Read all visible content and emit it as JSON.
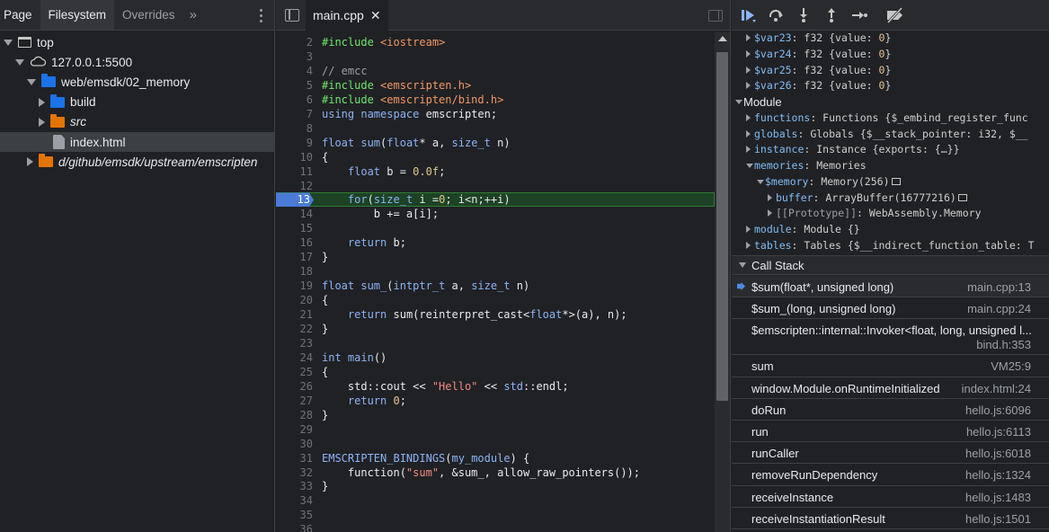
{
  "navigator": {
    "tabs": [
      "Page",
      "Filesystem",
      "Overrides"
    ],
    "more": "»",
    "tree": [
      {
        "label": "top",
        "icon": "frame-icon",
        "expanded": true,
        "indent": 0
      },
      {
        "label": "127.0.0.1:5500",
        "icon": "cloud-icon",
        "expanded": true,
        "indent": 1
      },
      {
        "label": "web/emsdk/02_memory",
        "icon": "folder-icon",
        "expanded": true,
        "indent": 2
      },
      {
        "label": "build",
        "icon": "folder-icon",
        "expanded": false,
        "indent": 3
      },
      {
        "label": "src",
        "icon": "folder-icon",
        "expanded": false,
        "indent": 3,
        "italic": true,
        "color": "orange"
      },
      {
        "label": "index.html",
        "icon": "file-icon",
        "indent": 3,
        "selected": true
      },
      {
        "label": "d/github/emsdk/upstream/emscripten",
        "icon": "folder-icon",
        "expanded": false,
        "indent": 2,
        "italic": true,
        "color": "orange"
      }
    ]
  },
  "editor": {
    "filename": "main.cpp",
    "close_glyph": "✕",
    "execution_line": 13,
    "lines": [
      {
        "n": "2",
        "html": "<span class=\"pp\">#include</span> <span class=\"inc\">&lt;iostream&gt;</span>"
      },
      {
        "n": "3",
        "html": ""
      },
      {
        "n": "4",
        "html": "<span class=\"com\">// emcc</span>"
      },
      {
        "n": "5",
        "html": "<span class=\"pp\">#include</span> <span class=\"inc\">&lt;emscripten.h&gt;</span>"
      },
      {
        "n": "6",
        "html": "<span class=\"pp\">#include</span> <span class=\"inc\">&lt;emscripten/bind.h&gt;</span>"
      },
      {
        "n": "7",
        "html": "<span class=\"kw\">using</span> <span class=\"kw\">namespace</span> emscripten;"
      },
      {
        "n": "8",
        "html": ""
      },
      {
        "n": "9",
        "html": "<span class=\"ty\">float</span> <span class=\"fn\">sum</span>(<span class=\"ty\">float</span>* a, <span class=\"ty\">size_t</span> n)"
      },
      {
        "n": "10",
        "html": "{"
      },
      {
        "n": "11",
        "html": "    <span class=\"ty\">float</span> b = <span class=\"num\">0.0f</span>;"
      },
      {
        "n": "12",
        "html": ""
      },
      {
        "n": "13",
        "html": "    <span class=\"kw\">for</span>(<span class=\"ty\">size_t</span> i =<span class=\"num\">0</span>; i&lt;n;++i)"
      },
      {
        "n": "14",
        "html": "        b += a[i];"
      },
      {
        "n": "15",
        "html": ""
      },
      {
        "n": "16",
        "html": "    <span class=\"kw\">return</span> b;"
      },
      {
        "n": "17",
        "html": "}"
      },
      {
        "n": "18",
        "html": ""
      },
      {
        "n": "19",
        "html": "<span class=\"ty\">float</span> <span class=\"fn\">sum_</span>(<span class=\"ty\">intptr_t</span> a, <span class=\"ty\">size_t</span> n)"
      },
      {
        "n": "20",
        "html": "{"
      },
      {
        "n": "21",
        "html": "    <span class=\"kw\">return</span> sum(reinterpret_cast&lt;<span class=\"ty\">float</span>*&gt;(a), n);"
      },
      {
        "n": "22",
        "html": "}"
      },
      {
        "n": "23",
        "html": ""
      },
      {
        "n": "24",
        "html": "<span class=\"ty\">int</span> <span class=\"fn\">main</span>()"
      },
      {
        "n": "25",
        "html": "{"
      },
      {
        "n": "26",
        "html": "    std::cout &lt;&lt; <span class=\"str\">\"Hello\"</span> &lt;&lt; <span class=\"ty\">std</span>::endl;"
      },
      {
        "n": "27",
        "html": "    <span class=\"kw\">return</span> <span class=\"num\">0</span>;"
      },
      {
        "n": "28",
        "html": "}"
      },
      {
        "n": "29",
        "html": ""
      },
      {
        "n": "30",
        "html": ""
      },
      {
        "n": "31",
        "html": "<span class=\"fn\">EMSCRIPTEN_BINDINGS</span>(<span class=\"fn\">my_module</span>) {"
      },
      {
        "n": "32",
        "html": "    function(<span class=\"str\">\"sum\"</span>, &amp;sum_, allow_raw_pointers());"
      },
      {
        "n": "33",
        "html": "}"
      },
      {
        "n": "34",
        "html": ""
      },
      {
        "n": "35",
        "html": ""
      },
      {
        "n": "36",
        "html": ""
      }
    ]
  },
  "scope": {
    "items": [
      {
        "depth": 0,
        "arrow": "right",
        "key": "$var23",
        "value": "f32 {value: 0}"
      },
      {
        "depth": 0,
        "arrow": "right",
        "key": "$var24",
        "value": "f32 {value: 0}"
      },
      {
        "depth": 0,
        "arrow": "right",
        "key": "$var25",
        "value": "f32 {value: 0}"
      },
      {
        "depth": 0,
        "arrow": "right",
        "key": "$var26",
        "value": "f32 {value: 0}"
      },
      {
        "depth": -1,
        "arrow": "down",
        "key": "Module",
        "value": "",
        "plain": true
      },
      {
        "depth": 0,
        "arrow": "right",
        "key": "functions",
        "value": "Functions {$_embind_register_func"
      },
      {
        "depth": 0,
        "arrow": "right",
        "key": "globals",
        "value": "Globals {$__stack_pointer: i32, $__"
      },
      {
        "depth": 0,
        "arrow": "right",
        "key": "instance",
        "value": "Instance {exports: {…}}"
      },
      {
        "depth": 0,
        "arrow": "down",
        "key": "memories",
        "value": "Memories"
      },
      {
        "depth": 1,
        "arrow": "down",
        "key": "$memory",
        "value": "Memory(256)",
        "memicon": true
      },
      {
        "depth": 2,
        "arrow": "right",
        "key": "buffer",
        "value": "ArrayBuffer(16777216)",
        "memicon": true
      },
      {
        "depth": 2,
        "arrow": "right",
        "key": "[[Prototype]]",
        "value": "WebAssembly.Memory",
        "proto": true
      },
      {
        "depth": 0,
        "arrow": "right",
        "key": "module",
        "value": "Module {}"
      },
      {
        "depth": 0,
        "arrow": "right",
        "key": "tables",
        "value": "Tables {$__indirect_function_table: T"
      }
    ]
  },
  "call_stack": {
    "title": "Call Stack",
    "frames": [
      {
        "name": "$sum(float*, unsigned long)",
        "location": "main.cpp:13",
        "current": true
      },
      {
        "name": "$sum_(long, unsigned long)",
        "location": "main.cpp:24"
      },
      {
        "name": "$emscripten::internal::Invoker<float, long, unsigned l...",
        "location": "bind.h:353",
        "twoline": true
      },
      {
        "name": "sum",
        "location": "VM25:9"
      },
      {
        "name": "window.Module.onRuntimeInitialized",
        "location": "index.html:24"
      },
      {
        "name": "doRun",
        "location": "hello.js:6096"
      },
      {
        "name": "run",
        "location": "hello.js:6113"
      },
      {
        "name": "runCaller",
        "location": "hello.js:6018"
      },
      {
        "name": "removeRunDependency",
        "location": "hello.js:1324"
      },
      {
        "name": "receiveInstance",
        "location": "hello.js:1483"
      },
      {
        "name": "receiveInstantiationResult",
        "location": "hello.js:1501"
      }
    ]
  }
}
